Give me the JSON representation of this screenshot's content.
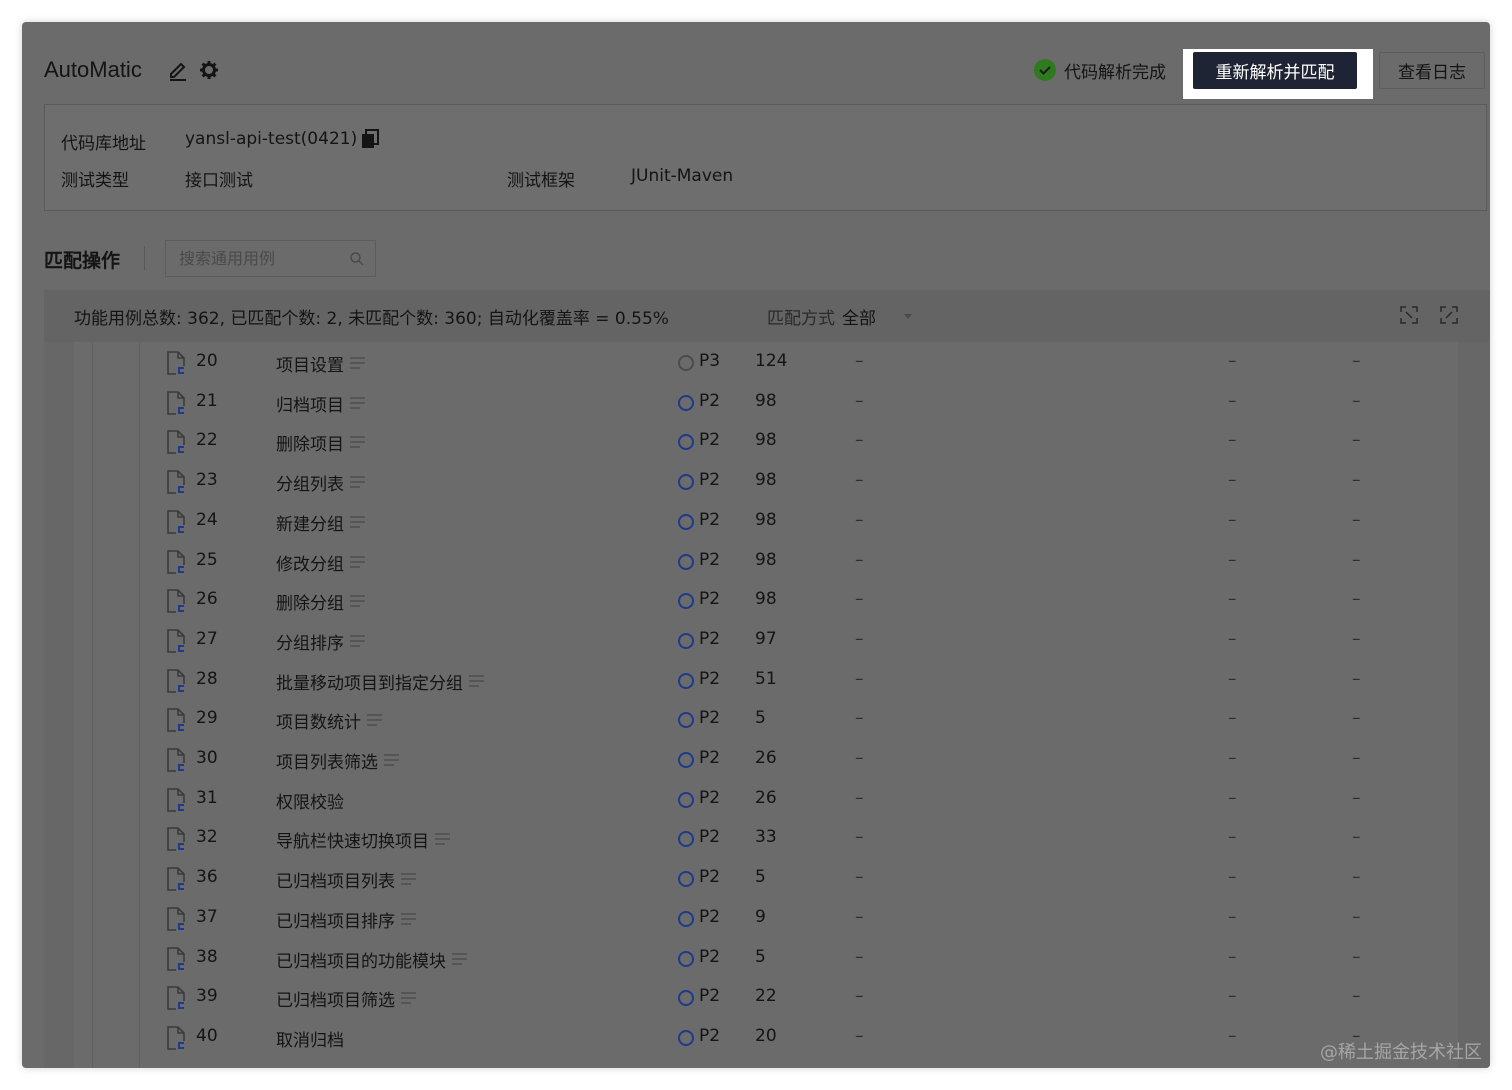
{
  "header": {
    "title": "AutoMatic",
    "edit_icon": "pencil-icon",
    "settings_icon": "gear-icon",
    "status_text": "代码解析完成",
    "status_color": "#52c41a",
    "reparse_label": "重新解析并匹配",
    "view_log_label": "查看日志"
  },
  "info": {
    "repo_label": "代码库地址",
    "repo_value": "yansl-api-test(0421)",
    "test_type_label": "测试类型",
    "test_type_value": "接口测试",
    "framework_label": "测试框架",
    "framework_value": "JUnit-Maven"
  },
  "match": {
    "title": "匹配操作",
    "search_placeholder": "搜索通用用例"
  },
  "summary": {
    "text": "功能用例总数: 362, 已匹配个数: 2, 未匹配个数: 360; 自动化覆盖率 = 0.55%",
    "match_mode_label": "匹配方式",
    "match_mode_value": "全部"
  },
  "priority_colors": {
    "P2": "#1e3a8a",
    "P3": "#4b4b4b"
  },
  "rows": [
    {
      "id": "20",
      "name": "项目设置",
      "has_desc": true,
      "priority": "P3",
      "count": "124",
      "c1": "–",
      "c2": "–",
      "c3": "–"
    },
    {
      "id": "21",
      "name": "归档项目",
      "has_desc": true,
      "priority": "P2",
      "count": "98",
      "c1": "–",
      "c2": "–",
      "c3": "–"
    },
    {
      "id": "22",
      "name": "删除项目",
      "has_desc": true,
      "priority": "P2",
      "count": "98",
      "c1": "–",
      "c2": "–",
      "c3": "–"
    },
    {
      "id": "23",
      "name": "分组列表",
      "has_desc": true,
      "priority": "P2",
      "count": "98",
      "c1": "–",
      "c2": "–",
      "c3": "–"
    },
    {
      "id": "24",
      "name": "新建分组",
      "has_desc": true,
      "priority": "P2",
      "count": "98",
      "c1": "–",
      "c2": "–",
      "c3": "–"
    },
    {
      "id": "25",
      "name": "修改分组",
      "has_desc": true,
      "priority": "P2",
      "count": "98",
      "c1": "–",
      "c2": "–",
      "c3": "–"
    },
    {
      "id": "26",
      "name": "删除分组",
      "has_desc": true,
      "priority": "P2",
      "count": "98",
      "c1": "–",
      "c2": "–",
      "c3": "–"
    },
    {
      "id": "27",
      "name": "分组排序",
      "has_desc": true,
      "priority": "P2",
      "count": "97",
      "c1": "–",
      "c2": "–",
      "c3": "–"
    },
    {
      "id": "28",
      "name": "批量移动项目到指定分组",
      "has_desc": true,
      "priority": "P2",
      "count": "51",
      "c1": "–",
      "c2": "–",
      "c3": "–"
    },
    {
      "id": "29",
      "name": "项目数统计",
      "has_desc": true,
      "priority": "P2",
      "count": "5",
      "c1": "–",
      "c2": "–",
      "c3": "–"
    },
    {
      "id": "30",
      "name": "项目列表筛选",
      "has_desc": true,
      "priority": "P2",
      "count": "26",
      "c1": "–",
      "c2": "–",
      "c3": "–"
    },
    {
      "id": "31",
      "name": "权限校验",
      "has_desc": false,
      "priority": "P2",
      "count": "26",
      "c1": "–",
      "c2": "–",
      "c3": "–"
    },
    {
      "id": "32",
      "name": "导航栏快速切换项目",
      "has_desc": true,
      "priority": "P2",
      "count": "33",
      "c1": "–",
      "c2": "–",
      "c3": "–"
    },
    {
      "id": "36",
      "name": "已归档项目列表",
      "has_desc": true,
      "priority": "P2",
      "count": "5",
      "c1": "–",
      "c2": "–",
      "c3": "–"
    },
    {
      "id": "37",
      "name": "已归档项目排序",
      "has_desc": true,
      "priority": "P2",
      "count": "9",
      "c1": "–",
      "c2": "–",
      "c3": "–"
    },
    {
      "id": "38",
      "name": "已归档项目的功能模块",
      "has_desc": true,
      "priority": "P2",
      "count": "5",
      "c1": "–",
      "c2": "–",
      "c3": "–"
    },
    {
      "id": "39",
      "name": "已归档项目筛选",
      "has_desc": true,
      "priority": "P2",
      "count": "22",
      "c1": "–",
      "c2": "–",
      "c3": "–"
    },
    {
      "id": "40",
      "name": "取消归档",
      "has_desc": false,
      "priority": "P2",
      "count": "20",
      "c1": "–",
      "c2": "–",
      "c3": "–"
    }
  ],
  "watermark": "@稀土掘金技术社区"
}
